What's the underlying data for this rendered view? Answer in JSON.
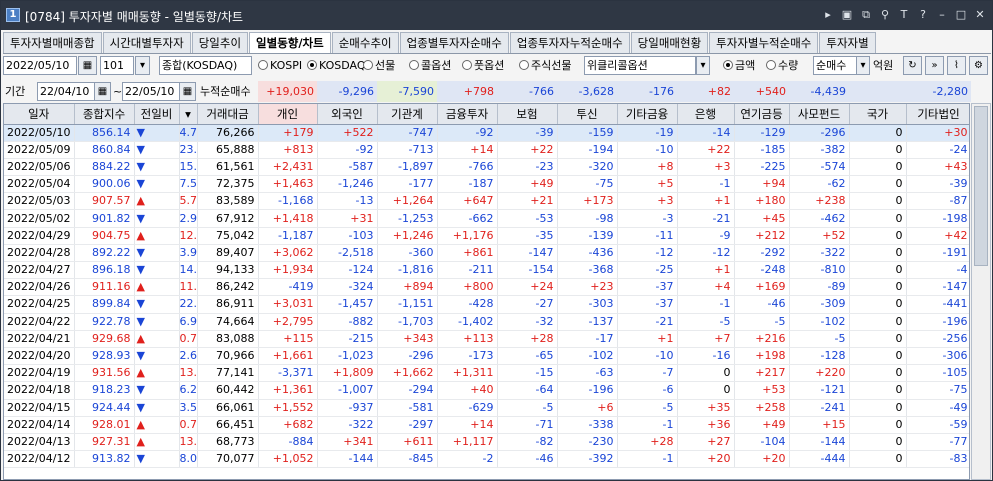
{
  "window": {
    "number": "1",
    "title": "[0784] 투자자별 매매동향 - 일별동향/차트"
  },
  "tabs": [
    "투자자별매매종합",
    "시간대별투자자",
    "당일추이",
    "일별동향/차트",
    "순매수추이",
    "업종별투자자순매수",
    "업종투자자누적순매수",
    "당일매매현황",
    "투자자별누적순매수",
    "투자자별"
  ],
  "active_tab": 3,
  "controls": {
    "date": "2022/05/10",
    "code": "101",
    "market": "종합(KOSDAQ)",
    "radios": [
      "KOSPI",
      "KOSDAQ",
      "선물",
      "콜옵션",
      "풋옵션",
      "주식선물"
    ],
    "radio_selected": 1,
    "weekly_option": "위클리콜옵션",
    "amount_radios": [
      "금액",
      "수량"
    ],
    "amount_selected": 0,
    "trade_type": "순매수",
    "unit": "억원"
  },
  "period": {
    "label": "기간",
    "from": "22/04/10",
    "sep": "~",
    "to": "22/05/10",
    "cum_label": "누적순매수"
  },
  "sums": [
    "+19,030",
    "-9,296",
    "-7,590",
    "+798",
    "-766",
    "-3,628",
    "-176",
    "+82",
    "+540",
    "-4,439",
    "",
    "-2,280"
  ],
  "columns": [
    "일자",
    "종합지수",
    "전일비",
    "",
    "거래대금",
    "개인",
    "외국인",
    "기관계",
    "금융투자",
    "보험",
    "투신",
    "기타금융",
    "은행",
    "연기금등",
    "사모펀드",
    "국가",
    "기타법인"
  ],
  "rows": [
    [
      "2022/05/10",
      "856.14",
      "v",
      "4.70",
      "76,266",
      "+179",
      "+522",
      "-747",
      "-92",
      "-39",
      "-159",
      "-19",
      "-14",
      "-129",
      "-296",
      "0",
      "+30"
    ],
    [
      "2022/05/09",
      "860.84",
      "v",
      "23.38",
      "65,888",
      "+813",
      "-92",
      "-713",
      "+14",
      "+22",
      "-194",
      "-10",
      "+22",
      "-185",
      "-382",
      "0",
      "-24"
    ],
    [
      "2022/05/06",
      "884.22",
      "v",
      "15.84",
      "61,561",
      "+2,431",
      "-587",
      "-1,897",
      "-766",
      "-23",
      "-320",
      "+8",
      "+3",
      "-225",
      "-574",
      "0",
      "+43"
    ],
    [
      "2022/05/04",
      "900.06",
      "v",
      "7.51",
      "72,375",
      "+1,463",
      "-1,246",
      "-177",
      "-187",
      "+49",
      "-75",
      "+5",
      "-1",
      "+94",
      "-62",
      "0",
      "-39"
    ],
    [
      "2022/05/03",
      "907.57",
      "u",
      "5.75",
      "83,589",
      "-1,168",
      "-13",
      "+1,264",
      "+647",
      "+21",
      "+173",
      "+3",
      "+1",
      "+180",
      "+238",
      "0",
      "-87"
    ],
    [
      "2022/05/02",
      "901.82",
      "v",
      "2.93",
      "67,912",
      "+1,418",
      "+31",
      "-1,253",
      "-662",
      "-53",
      "-98",
      "-3",
      "-21",
      "+45",
      "-462",
      "0",
      "-198"
    ],
    [
      "2022/04/29",
      "904.75",
      "u",
      "12.53",
      "75,042",
      "-1,187",
      "-103",
      "+1,246",
      "+1,176",
      "-35",
      "-139",
      "-11",
      "-9",
      "+212",
      "+52",
      "0",
      "+42"
    ],
    [
      "2022/04/28",
      "892.22",
      "v",
      "3.96",
      "89,407",
      "+3,062",
      "-2,518",
      "-360",
      "+861",
      "-147",
      "-436",
      "-12",
      "-12",
      "-292",
      "-322",
      "0",
      "-191"
    ],
    [
      "2022/04/27",
      "896.18",
      "v",
      "14.98",
      "94,133",
      "+1,934",
      "-124",
      "-1,816",
      "-211",
      "-154",
      "-368",
      "-25",
      "+1",
      "-248",
      "-810",
      "0",
      "-4"
    ],
    [
      "2022/04/26",
      "911.16",
      "u",
      "11.32",
      "86,242",
      "-419",
      "-324",
      "+894",
      "+800",
      "+24",
      "+23",
      "-37",
      "+4",
      "+169",
      "-89",
      "0",
      "-147"
    ],
    [
      "2022/04/25",
      "899.84",
      "v",
      "22.94",
      "86,911",
      "+3,031",
      "-1,457",
      "-1,151",
      "-428",
      "-27",
      "-303",
      "-37",
      "-1",
      "-46",
      "-309",
      "0",
      "-441"
    ],
    [
      "2022/04/22",
      "922.78",
      "v",
      "6.90",
      "74,664",
      "+2,795",
      "-882",
      "-1,703",
      "-1,402",
      "-32",
      "-137",
      "-21",
      "-5",
      "-5",
      "-102",
      "0",
      "-196"
    ],
    [
      "2022/04/21",
      "929.68",
      "u",
      "0.75",
      "83,088",
      "+115",
      "-215",
      "+343",
      "+113",
      "+28",
      "-17",
      "+1",
      "+7",
      "+216",
      "-5",
      "0",
      "-256"
    ],
    [
      "2022/04/20",
      "928.93",
      "v",
      "2.63",
      "70,966",
      "+1,661",
      "-1,023",
      "-296",
      "-173",
      "-65",
      "-102",
      "-10",
      "-16",
      "+198",
      "-128",
      "0",
      "-306"
    ],
    [
      "2022/04/19",
      "931.56",
      "u",
      "13.33",
      "77,141",
      "-3,371",
      "+1,809",
      "+1,662",
      "+1,311",
      "-15",
      "-63",
      "-7",
      "0",
      "+217",
      "+220",
      "0",
      "-105"
    ],
    [
      "2022/04/18",
      "918.23",
      "v",
      "6.21",
      "60,442",
      "+1,361",
      "-1,007",
      "-294",
      "+40",
      "-64",
      "-196",
      "-6",
      "0",
      "+53",
      "-121",
      "0",
      "-75"
    ],
    [
      "2022/04/15",
      "924.44",
      "v",
      "3.57",
      "66,061",
      "+1,552",
      "-937",
      "-581",
      "-629",
      "-5",
      "+6",
      "-5",
      "+35",
      "+258",
      "-241",
      "0",
      "-49"
    ],
    [
      "2022/04/14",
      "928.01",
      "u",
      "0.70",
      "66,451",
      "+682",
      "-322",
      "-297",
      "+14",
      "-71",
      "-338",
      "-1",
      "+36",
      "+49",
      "+15",
      "0",
      "-59"
    ],
    [
      "2022/04/13",
      "927.31",
      "u",
      "13.49",
      "68,773",
      "-884",
      "+341",
      "+611",
      "+1,117",
      "-82",
      "-230",
      "+28",
      "+27",
      "-104",
      "-144",
      "0",
      "-77"
    ],
    [
      "2022/04/12",
      "913.82",
      "v",
      "8.01",
      "70,077",
      "+1,052",
      "-144",
      "-845",
      "-2",
      "-46",
      "-392",
      "-1",
      "+20",
      "+20",
      "-444",
      "0",
      "-83"
    ]
  ],
  "icons": [
    "settings-icon",
    "chart-icon",
    "refresh-icon",
    "next-icon",
    "calendar-icon",
    "minimize-icon",
    "close-icon"
  ]
}
